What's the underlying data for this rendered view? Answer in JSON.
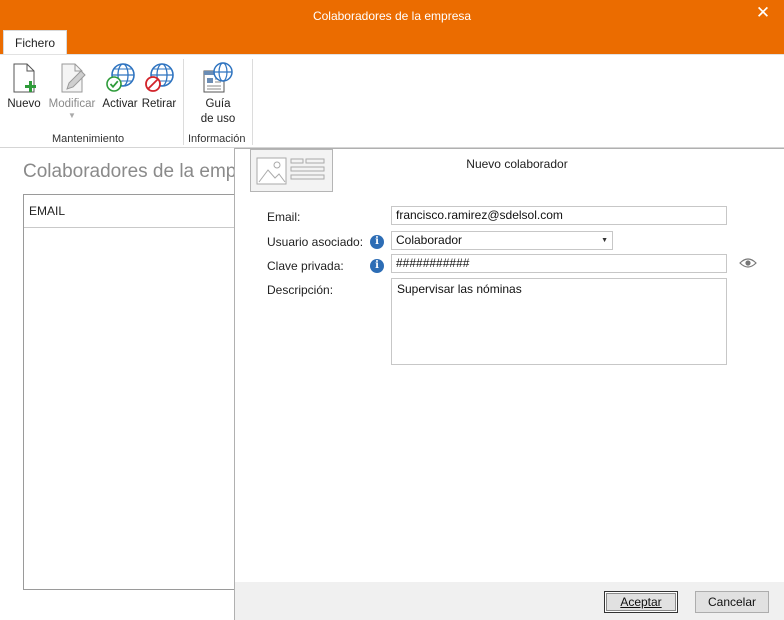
{
  "window": {
    "title": "Colaboradores de la empresa"
  },
  "ribbon": {
    "tab": "Fichero",
    "buttons": {
      "nuevo": "Nuevo",
      "modificar": "Modificar",
      "activar": "Activar",
      "retirar": "Retirar",
      "guia_line1": "Guía",
      "guia_line2": "de uso"
    },
    "groups": {
      "mantenimiento": "Mantenimiento",
      "informacion": "Información"
    }
  },
  "list": {
    "title": "Colaboradores de la emp",
    "column_email": "EMAIL"
  },
  "form": {
    "title": "Nuevo colaborador",
    "email_label": "Email:",
    "email_value": "francisco.ramirez@sdelsol.com",
    "usuario_label": "Usuario asociado:",
    "usuario_value": "Colaborador",
    "clave_label": "Clave privada:",
    "clave_value": "###########",
    "descripcion_label": "Descripción:",
    "descripcion_value": "Supervisar las nóminas"
  },
  "footer": {
    "accept": "Aceptar",
    "cancel": "Cancelar"
  },
  "colors": {
    "title_bar": "#eb6c00",
    "info_icon": "#2d6db5",
    "globe": "#2f74c0"
  }
}
